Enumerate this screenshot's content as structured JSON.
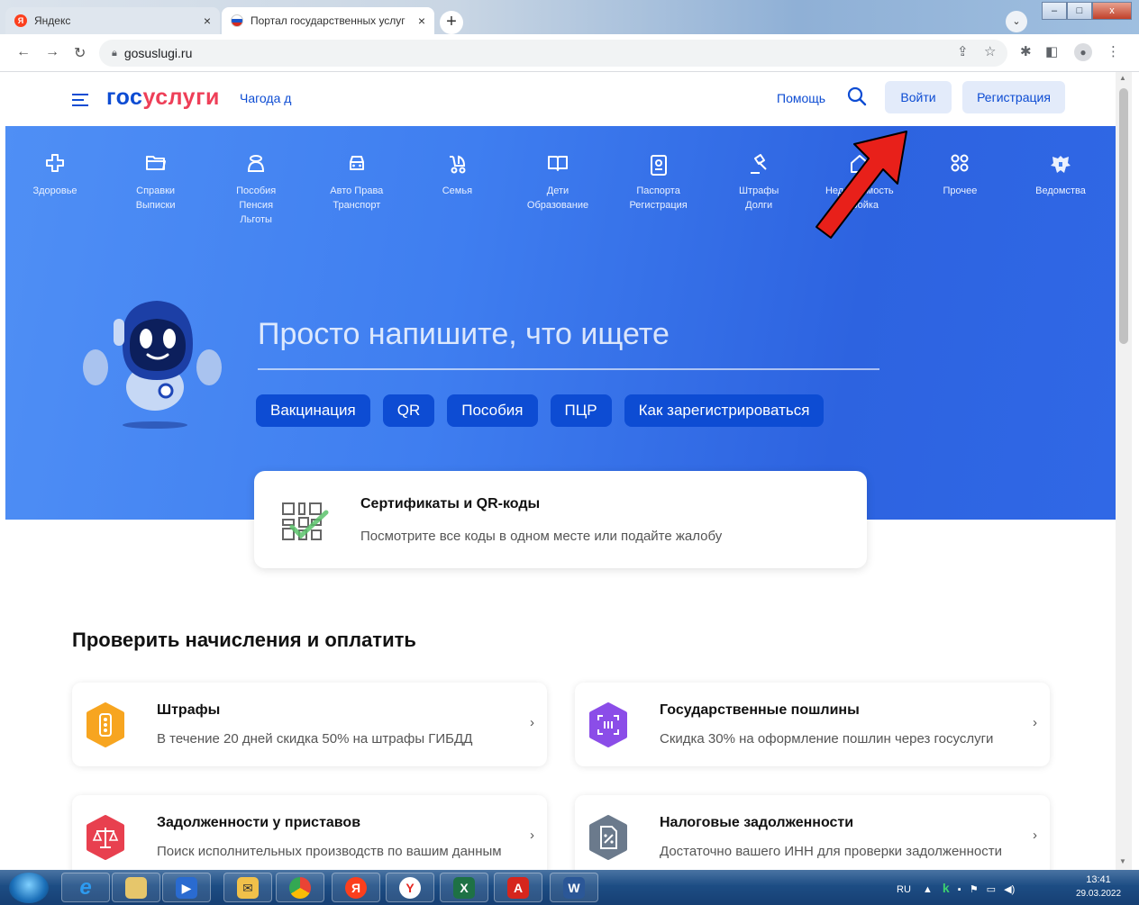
{
  "browser": {
    "tabs": [
      {
        "title": "Яндекс",
        "close": "×"
      },
      {
        "title": "Портал государственных услуг",
        "close": "×"
      }
    ],
    "new_tab": "+",
    "window": {
      "minimize": "‒",
      "maximize": "□",
      "close": "x"
    },
    "address": "gosuslugi.ru"
  },
  "header": {
    "logo_part1": "гос",
    "logo_part2": "услуги",
    "city": "Чагода д",
    "help": "Помощь",
    "login": "Войти",
    "register": "Регистрация"
  },
  "categories": [
    {
      "label": "Здоровье",
      "icon": "medical-cross-icon"
    },
    {
      "label": "Справки\nВыписки",
      "icon": "folder-icon"
    },
    {
      "label": "Пособия\nПенсия\nЛьготы",
      "icon": "coin-stack-icon"
    },
    {
      "label": "Авто Права\nТранспорт",
      "icon": "car-icon"
    },
    {
      "label": "Семья",
      "icon": "stroller-icon"
    },
    {
      "label": "Дети\nОбразование",
      "icon": "book-icon"
    },
    {
      "label": "Паспорта\nРегистрация",
      "icon": "passport-icon"
    },
    {
      "label": "Штрафы\nДолги",
      "icon": "gavel-icon"
    },
    {
      "label": "Недвижимость\nСтройка",
      "icon": "house-icon"
    },
    {
      "label": "Прочее",
      "icon": "grid-icon"
    },
    {
      "label": "Ведомства",
      "icon": "coat-of-arms-icon"
    }
  ],
  "search": {
    "prompt": "Просто напишите, что ищете",
    "chips": [
      "Вакцинация",
      "QR",
      "Пособия",
      "ПЦР",
      "Как зарегистрироваться"
    ]
  },
  "qr_card": {
    "title": "Сертификаты и QR-коды",
    "subtitle": "Посмотрите все коды в одном месте или подайте жалобу"
  },
  "section": {
    "title": "Проверить начисления и оплатить",
    "cards": [
      {
        "title": "Штрафы",
        "subtitle": "В течение 20 дней скидка 50% на штрафы ГИБДД",
        "icon": "traffic-light-icon",
        "color": "#f7a520"
      },
      {
        "title": "Государственные пошлины",
        "subtitle": "Скидка 30% на оформление пошлин через госуслуги",
        "icon": "receipt-scan-icon",
        "color": "#8b4de8"
      },
      {
        "title": "Задолженности у приставов",
        "subtitle": "Поиск исполнительных производств по вашим данным",
        "icon": "scales-icon",
        "color": "#e8404f"
      },
      {
        "title": "Налоговые задолженности",
        "subtitle": "Достаточно вашего ИНН для проверки задолженности",
        "icon": "tax-document-icon",
        "color": "#6b7a8c"
      }
    ],
    "chevron": "›"
  },
  "taskbar": {
    "language": "RU",
    "time": "13:41",
    "date": "29.03.2022"
  },
  "colors": {
    "brand_blue": "#0d4cd3",
    "brand_red": "#ee3f58",
    "hero_blue": "#3f7ef0",
    "annotation_arrow": "#e8201a"
  }
}
